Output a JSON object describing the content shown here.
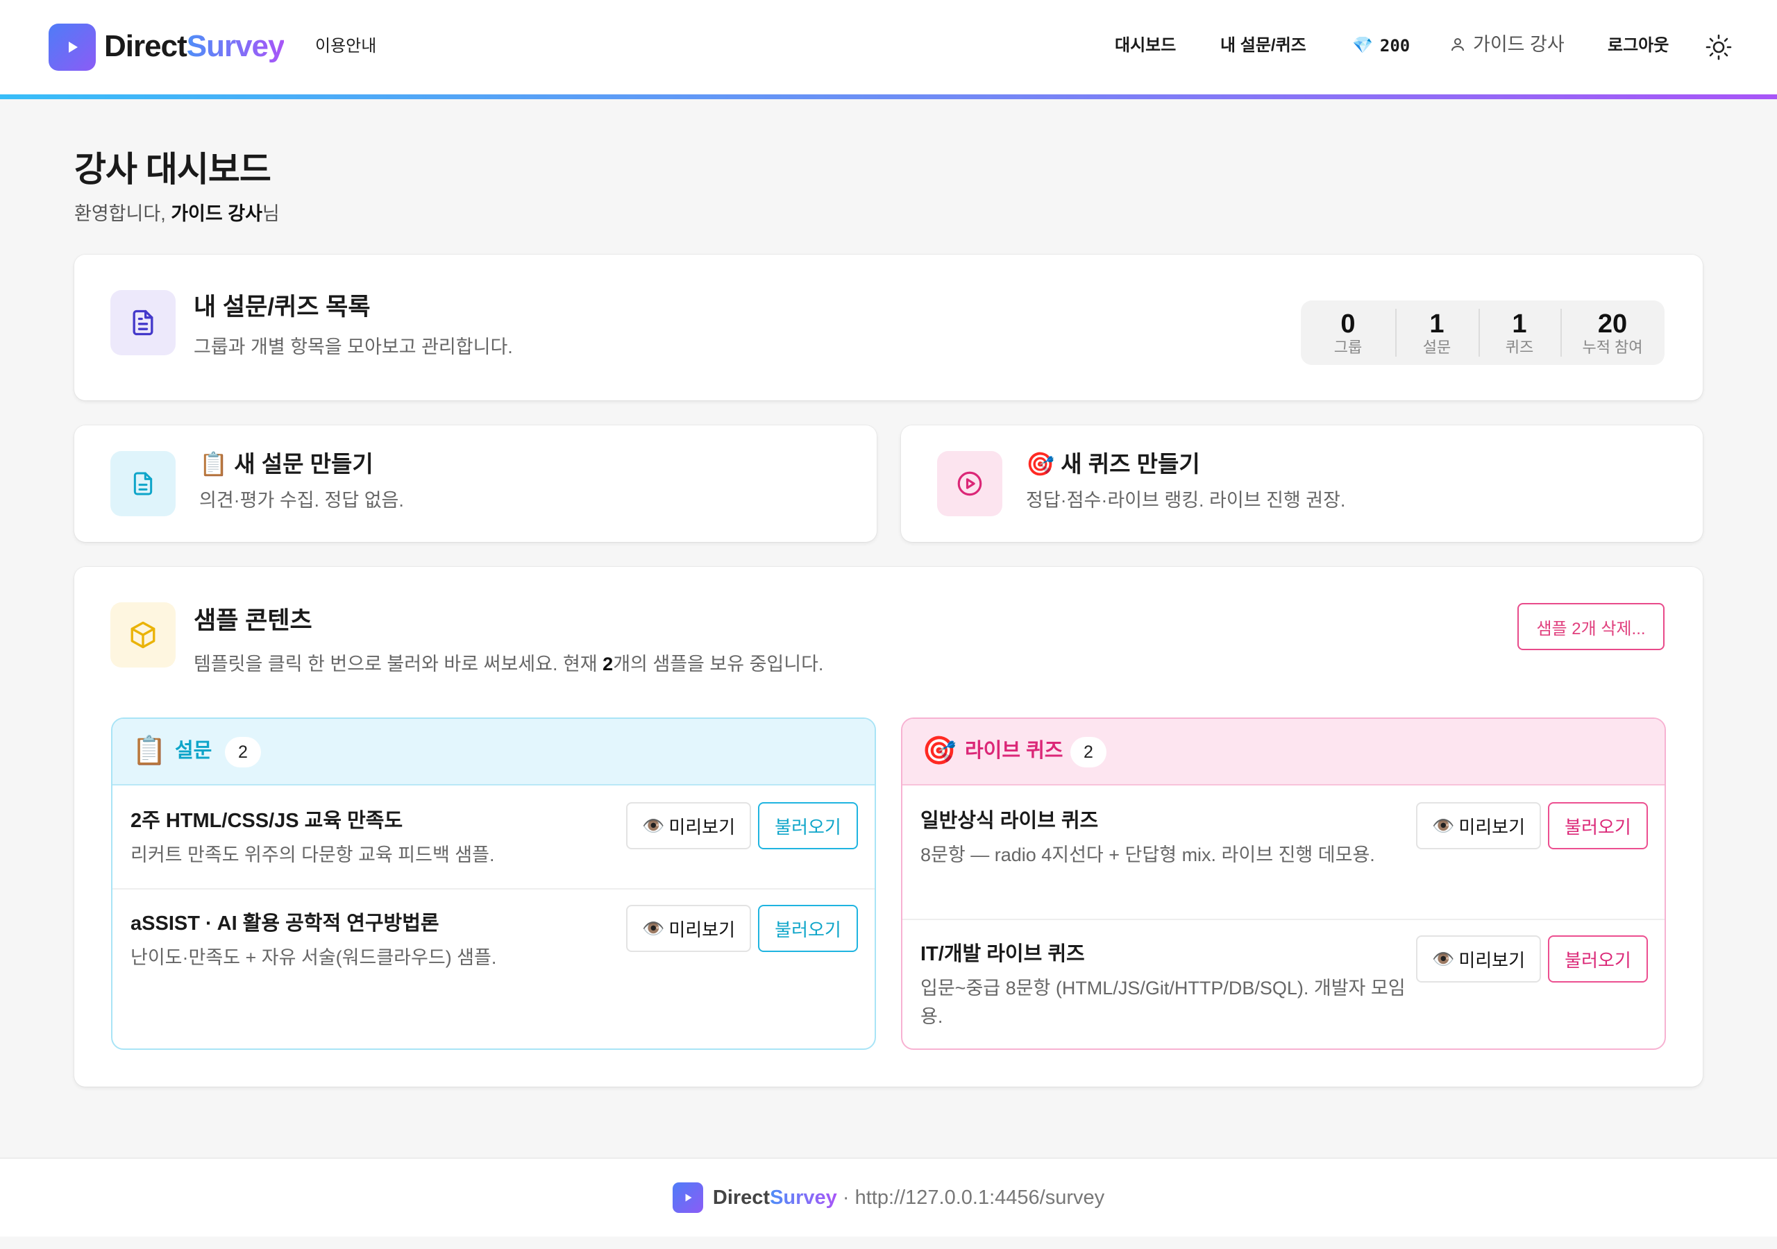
{
  "header": {
    "brand_part1": "Direct",
    "brand_part2": "Survey",
    "guide_link": "이용안내",
    "nav_dashboard": "대시보드",
    "nav_my": "내 설문/퀴즈",
    "gem_icon": "💎",
    "gem_count": "200",
    "user_name": "가이드 강사",
    "logout": "로그아웃",
    "accent_gradient": [
      "#38bdf8",
      "#a855f7"
    ]
  },
  "page": {
    "title": "강사 대시보드",
    "welcome_prefix": "환영합니다, ",
    "welcome_name": "가이드 강사",
    "welcome_suffix": "님"
  },
  "list_card": {
    "title": "내 설문/퀴즈 목록",
    "desc": "그룹과 개별 항목을 모아보고 관리합니다.",
    "stats": [
      {
        "value": "0",
        "label": "그룹"
      },
      {
        "value": "1",
        "label": "설문"
      },
      {
        "value": "1",
        "label": "퀴즈"
      },
      {
        "value": "20",
        "label": "누적 참여"
      }
    ]
  },
  "create_survey": {
    "emoji": "📋",
    "title": "새 설문 만들기",
    "desc": "의견·평가 수집. 정답 없음."
  },
  "create_quiz": {
    "emoji": "🎯",
    "title": "새 퀴즈 만들기",
    "desc": "정답·점수·라이브 랭킹. 라이브 진행 권장."
  },
  "samples": {
    "title": "샘플 콘텐츠",
    "desc_prefix": "템플릿을 클릭 한 번으로 불러와 바로 써보세요. 현재 ",
    "desc_count": "2",
    "desc_suffix": "개의 샘플을 보유 중입니다.",
    "delete_button": "샘플 2개 삭제...",
    "survey_panel": {
      "emoji": "📋",
      "title": "설문",
      "count": "2",
      "items": [
        {
          "title": "2주 HTML/CSS/JS 교육 만족도",
          "desc": "리커트 만족도 위주의 다문항 교육 피드백 샘플."
        },
        {
          "title": "aSSIST · AI 활용 공학적 연구방법론",
          "desc": "난이도·만족도 + 자유 서술(워드클라우드) 샘플."
        }
      ]
    },
    "quiz_panel": {
      "emoji": "🎯",
      "title": "라이브 퀴즈",
      "count": "2",
      "items": [
        {
          "title": "일반상식 라이브 퀴즈",
          "desc": "8문항 — radio 4지선다 + 단답형 mix. 라이브 진행 데모용."
        },
        {
          "title": "IT/개발 라이브 퀴즈",
          "desc": "입문~중급 8문항 (HTML/JS/Git/HTTP/DB/SQL). 개발자 모임용."
        }
      ]
    },
    "preview_icon": "👁️",
    "preview_label": "미리보기",
    "load_label": "불러오기"
  },
  "footer": {
    "brand_part1": "Direct",
    "brand_part2": "Survey",
    "url": " · http://127.0.0.1:4456/survey"
  }
}
